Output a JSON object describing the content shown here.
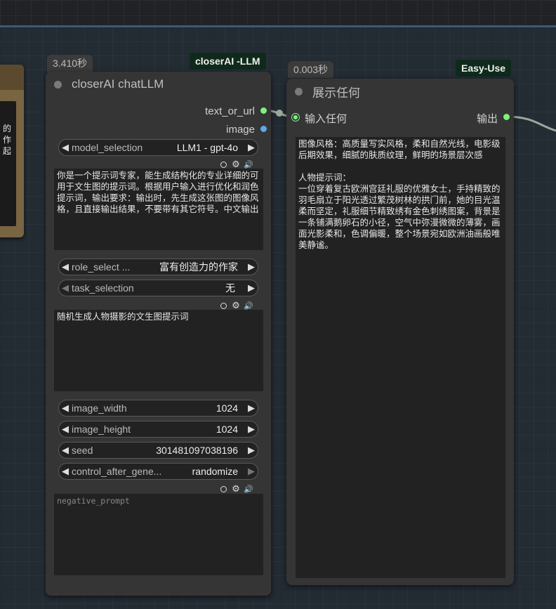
{
  "left_node": {
    "text_fragment": "的\n作\n起"
  },
  "llm_node": {
    "time_badge": "3.410秒",
    "tag": "closerAI -LLM",
    "title": "closerAI chatLLM",
    "outputs": [
      "text_or_url",
      "image"
    ],
    "model_selection": {
      "name": "model_selection",
      "value": "LLM1 - gpt-4o"
    },
    "prompt_text": "你是一个提示词专家，能生成结构化的专业详细的可用于文生图的提示词。根据用户输入进行优化和润色提示词，输出要求：输出时，先生成这张图的图像风格，且直接输出结果，不要带有其它符号。中文输出",
    "role_select": {
      "name": "role_select ...",
      "value": "富有创造力的作家"
    },
    "task_selection": {
      "name": "task_selection",
      "value": "无"
    },
    "user_text": "随机生成人物摄影的文生图提示词",
    "image_width": {
      "name": "image_width",
      "value": "1024"
    },
    "image_height": {
      "name": "image_height",
      "value": "1024"
    },
    "seed": {
      "name": "seed",
      "value": "301481097038196"
    },
    "control_after_generate": {
      "name": "control_after_gene...",
      "value": "randomize"
    },
    "negative_placeholder": "negative_prompt"
  },
  "show_node": {
    "time_badge": "0.003秒",
    "tag": "Easy-Use",
    "title": "展示任何",
    "input_label": "输入任何",
    "output_label": "输出",
    "content": "图像风格：高质量写实风格，柔和自然光线，电影级后期效果，细腻的肤质纹理，鲜明的场景层次感\n\n人物提示词：\n一位穿着复古欧洲宫廷礼服的优雅女士，手持精致的羽毛扇立于阳光透过繁茂树林的拱门前，她的目光温柔而坚定，礼服细节精致绣有金色刺绣图案，背景是一条铺满鹅卵石的小径，空气中弥漫微微的薄雾，画面光影柔和，色调偏暖，整个场景宛如欧洲油画般唯美静谧。"
  },
  "colors": {
    "socket_green": "#7cf27c",
    "socket_blue": "#5fa8e8",
    "tag_bg": "#0f2a1b"
  }
}
